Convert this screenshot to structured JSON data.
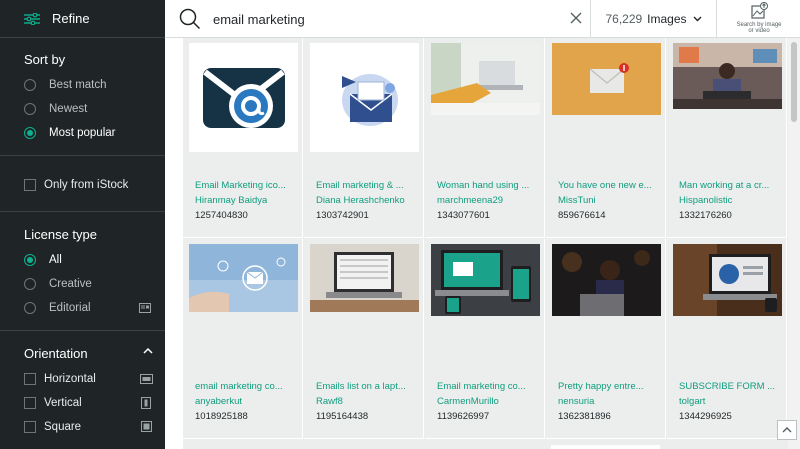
{
  "sidebar": {
    "refine_label": "Refine",
    "sort_by": {
      "title": "Sort by",
      "options": [
        "Best match",
        "Newest",
        "Most popular"
      ],
      "selected": "Most popular"
    },
    "only_istock_label": "Only from iStock",
    "license_type": {
      "title": "License type",
      "options": [
        "All",
        "Creative",
        "Editorial"
      ],
      "selected": "All"
    },
    "orientation": {
      "title": "Orientation",
      "options": [
        "Horizontal",
        "Vertical",
        "Square"
      ]
    }
  },
  "header": {
    "search_value": "email marketing",
    "result_count": "76,229",
    "media_type": "Images",
    "image_search_label_1": "Search by image",
    "image_search_label_2": "or video"
  },
  "results": [
    {
      "title": "Email Marketing ico...",
      "author": "Hiranmay Baidya",
      "id": "1257404830"
    },
    {
      "title": "Email marketing & ...",
      "author": "Diana Herashchenko",
      "id": "1303742901"
    },
    {
      "title": "Woman hand using ...",
      "author": "marchmeena29",
      "id": "1343077601"
    },
    {
      "title": "You have one new e...",
      "author": "MissTuni",
      "id": "859676614"
    },
    {
      "title": "Man working at a cr...",
      "author": "Hispanolistic",
      "id": "1332176260"
    },
    {
      "title": "email marketing co...",
      "author": "anyaberkut",
      "id": "1018925188"
    },
    {
      "title": "Emails list on a lapt...",
      "author": "Rawf8",
      "id": "1195164438"
    },
    {
      "title": "Email marketing co...",
      "author": "CarmenMurillo",
      "id": "1139626997"
    },
    {
      "title": "Pretty happy entre...",
      "author": "nensuria",
      "id": "1362381896"
    },
    {
      "title": "SUBSCRIBE FORM ...",
      "author": "tolgart",
      "id": "1344296925"
    }
  ],
  "colors": {
    "accent": "#0cb28f",
    "sidebar_bg": "#1f2527",
    "link": "#0f9d7e"
  }
}
